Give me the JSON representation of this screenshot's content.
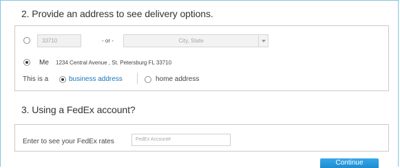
{
  "address_section": {
    "title": "2. Provide an address to see delivery options.",
    "zip_input": {
      "value": "33710"
    },
    "or_separator": "- or -",
    "city_state_input": {
      "placeholder": "City, State"
    },
    "saved_address": {
      "label": "Me",
      "address": "1234 Central Avenue , St. Petersburg FL 33710",
      "selected": true
    },
    "address_type": {
      "prefix": "This is a",
      "options": [
        "business address",
        "home address"
      ],
      "selected": "business address"
    }
  },
  "account_section": {
    "title": "3. Using a FedEx account?",
    "label": "Enter to see your FedEx rates",
    "account_input": {
      "placeholder": "FedEx Account#"
    }
  },
  "continue_button": {
    "label": "Continue"
  },
  "colors": {
    "accent_blue": "#1a75bb",
    "button_blue": "#2a9ae0",
    "frame_border": "#7fc4dd"
  }
}
